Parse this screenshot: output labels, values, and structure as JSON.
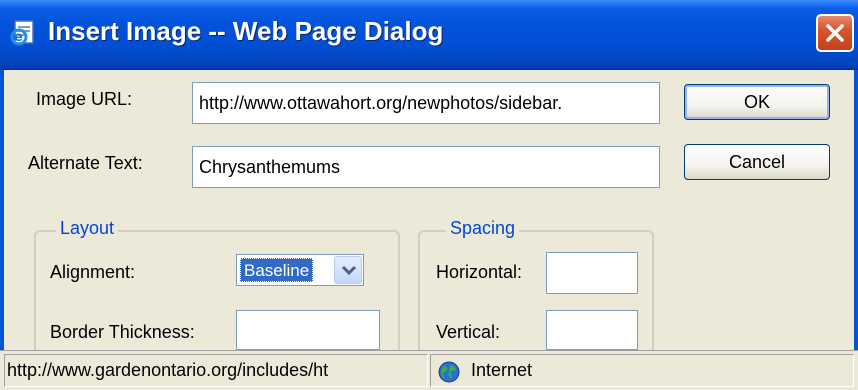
{
  "window": {
    "title": "Insert Image -- Web Page Dialog",
    "app_icon": "ie-page-icon",
    "close_icon": "close-icon",
    "titlebar_color": "#0352da",
    "close_color": "#d8552d"
  },
  "form": {
    "image_url_label": "Image URL:",
    "image_url_value": "http://www.ottawahort.org/newphotos/sidebar.",
    "alt_text_label": "Alternate Text:",
    "alt_text_value": "Chrysanthemums",
    "ok_label": "OK",
    "cancel_label": "Cancel"
  },
  "layout_group": {
    "legend": "Layout",
    "alignment_label": "Alignment:",
    "alignment_value": "Baseline",
    "border_thickness_label": "Border Thickness:",
    "border_thickness_value": ""
  },
  "spacing_group": {
    "legend": "Spacing",
    "horizontal_label": "Horizontal:",
    "horizontal_value": "",
    "vertical_label": "Vertical:",
    "vertical_value": ""
  },
  "statusbar": {
    "url_text": "http://www.gardenontario.org/includes/ht",
    "zone_icon": "globe-icon",
    "zone_text": "Internet"
  },
  "colors": {
    "legend_text": "#0046d5",
    "selection": "#316ac5",
    "dialog_bg": "#ece9d8"
  }
}
